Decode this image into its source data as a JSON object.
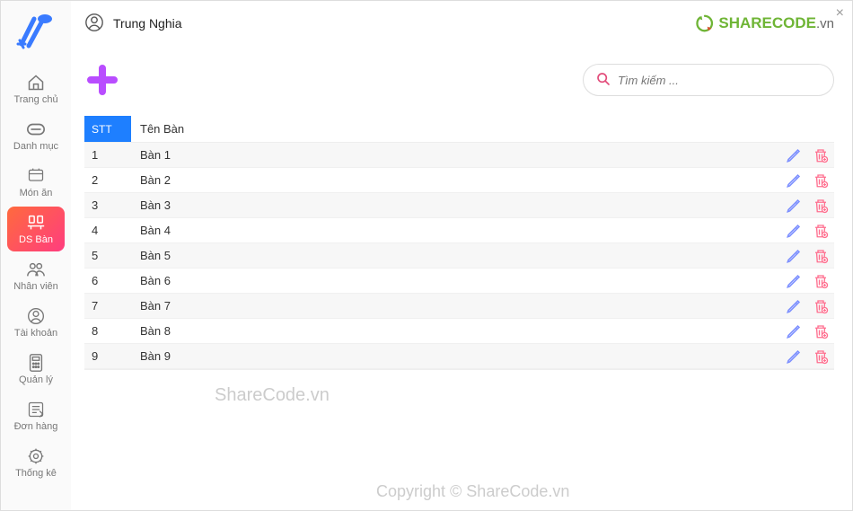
{
  "user": {
    "name": "Trung Nghia"
  },
  "brand": {
    "text": "SHARECODE",
    "suffix": ".vn",
    "accent": "#6fb536",
    "icon_color": "#6fb536"
  },
  "sidebar": {
    "items": [
      {
        "label": "Trang chủ",
        "icon": "home-icon"
      },
      {
        "label": "Danh mục",
        "icon": "list-icon"
      },
      {
        "label": "Món ăn",
        "icon": "food-icon"
      },
      {
        "label": "DS Bàn",
        "icon": "table-icon"
      },
      {
        "label": "Nhân viên",
        "icon": "staff-icon"
      },
      {
        "label": "Tài khoản",
        "icon": "account-icon"
      },
      {
        "label": "Quản lý",
        "icon": "manage-icon"
      },
      {
        "label": "Đơn hàng",
        "icon": "order-icon"
      },
      {
        "label": "Thống kê",
        "icon": "stats-icon"
      }
    ],
    "active_index": 3
  },
  "toolbar": {
    "add_tooltip": "Add",
    "search_placeholder": "Tìm kiếm ..."
  },
  "table": {
    "headers": {
      "stt": "STT",
      "name": "Tên Bàn"
    },
    "rows": [
      {
        "stt": "1",
        "name": "Bàn 1"
      },
      {
        "stt": "2",
        "name": "Bàn 2"
      },
      {
        "stt": "3",
        "name": "Bàn 3"
      },
      {
        "stt": "4",
        "name": "Bàn 4"
      },
      {
        "stt": "5",
        "name": "Bàn 5"
      },
      {
        "stt": "6",
        "name": "Bàn 6"
      },
      {
        "stt": "7",
        "name": "Bàn 7"
      },
      {
        "stt": "8",
        "name": "Bàn 8"
      },
      {
        "stt": "9",
        "name": "Bàn 9"
      }
    ]
  },
  "watermarks": {
    "w1": "ShareCode.vn",
    "w2": "Copyright © ShareCode.vn"
  },
  "colors": {
    "primary": "#1e7fff",
    "gradient_a": "#ff6a3d",
    "gradient_b": "#ff3d7f",
    "add_btn": "#b94dff",
    "edit_icon": "#7c8fff",
    "delete_icon": "#ff6f8f",
    "search_icon": "#e24c7a"
  }
}
